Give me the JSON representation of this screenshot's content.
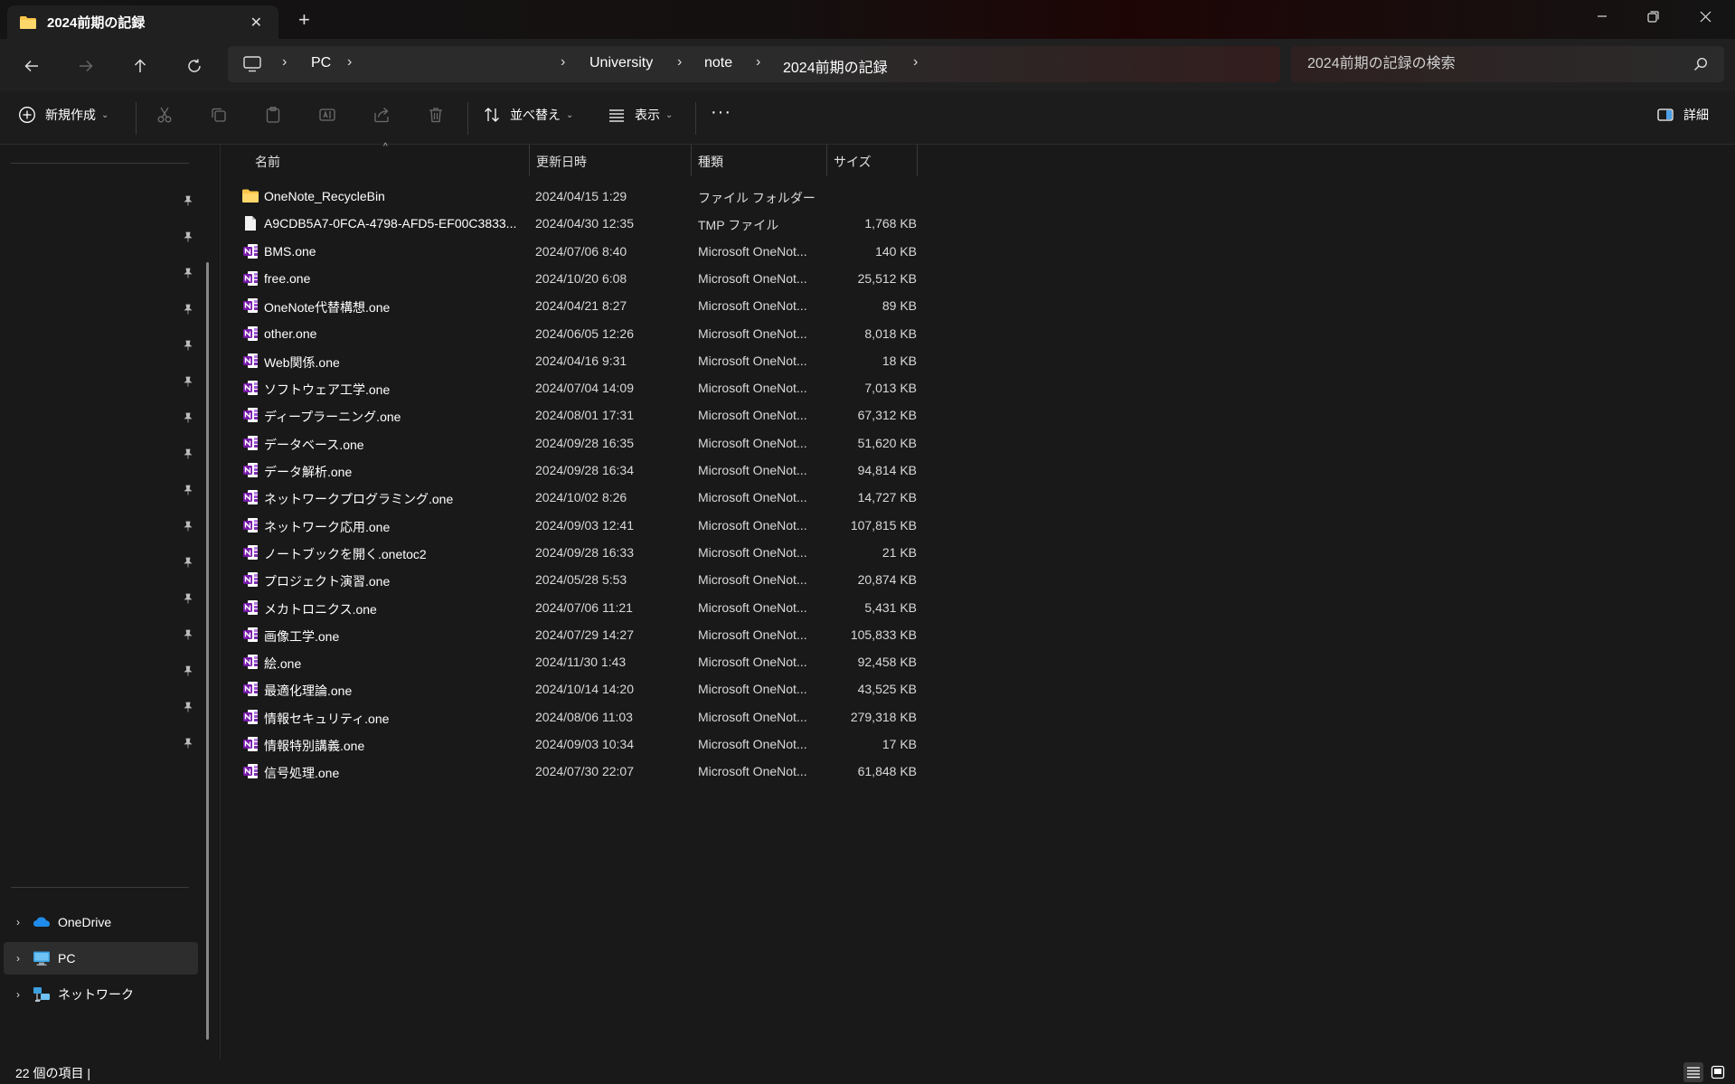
{
  "window": {
    "tab_title": "2024前期の記録",
    "tab_close": "✕",
    "new_tab": "+"
  },
  "address": {
    "crumbs": [
      "PC",
      "University",
      "note",
      "2024前期の記録"
    ],
    "separator": "›",
    "search_placeholder": "2024前期の記録の検索"
  },
  "toolbar": {
    "new_label": "新規作成",
    "sort_label": "並べ替え",
    "view_label": "表示",
    "more_label": "···",
    "details_label": "詳細",
    "chevron": "⌄"
  },
  "sidebar": {
    "items": [
      {
        "label": "OneDrive",
        "icon": "onedrive-icon"
      },
      {
        "label": "PC",
        "icon": "pc-icon"
      },
      {
        "label": "ネットワーク",
        "icon": "network-icon"
      }
    ],
    "expand_glyph": "›"
  },
  "columns": {
    "name": "名前",
    "date": "更新日時",
    "type": "種類",
    "size": "サイズ"
  },
  "files": [
    {
      "name": "OneNote_RecycleBin",
      "date": "2024/04/15 1:29",
      "type": "ファイル フォルダー",
      "size": "",
      "icon": "folder-icon"
    },
    {
      "name": "A9CDB5A7-0FCA-4798-AFD5-EF00C3833...",
      "date": "2024/04/30 12:35",
      "type": "TMP ファイル",
      "size": "1,768 KB",
      "icon": "file-icon"
    },
    {
      "name": "BMS.one",
      "date": "2024/07/06 8:40",
      "type": "Microsoft OneNot...",
      "size": "140 KB",
      "icon": "onenote-icon"
    },
    {
      "name": "free.one",
      "date": "2024/10/20 6:08",
      "type": "Microsoft OneNot...",
      "size": "25,512 KB",
      "icon": "onenote-icon"
    },
    {
      "name": "OneNote代替構想.one",
      "date": "2024/04/21 8:27",
      "type": "Microsoft OneNot...",
      "size": "89 KB",
      "icon": "onenote-icon"
    },
    {
      "name": "other.one",
      "date": "2024/06/05 12:26",
      "type": "Microsoft OneNot...",
      "size": "8,018 KB",
      "icon": "onenote-icon"
    },
    {
      "name": "Web関係.one",
      "date": "2024/04/16 9:31",
      "type": "Microsoft OneNot...",
      "size": "18 KB",
      "icon": "onenote-icon"
    },
    {
      "name": "ソフトウェア工学.one",
      "date": "2024/07/04 14:09",
      "type": "Microsoft OneNot...",
      "size": "7,013 KB",
      "icon": "onenote-icon"
    },
    {
      "name": "ディープラーニング.one",
      "date": "2024/08/01 17:31",
      "type": "Microsoft OneNot...",
      "size": "67,312 KB",
      "icon": "onenote-icon"
    },
    {
      "name": "データベース.one",
      "date": "2024/09/28 16:35",
      "type": "Microsoft OneNot...",
      "size": "51,620 KB",
      "icon": "onenote-icon"
    },
    {
      "name": "データ解析.one",
      "date": "2024/09/28 16:34",
      "type": "Microsoft OneNot...",
      "size": "94,814 KB",
      "icon": "onenote-icon"
    },
    {
      "name": "ネットワークプログラミング.one",
      "date": "2024/10/02 8:26",
      "type": "Microsoft OneNot...",
      "size": "14,727 KB",
      "icon": "onenote-icon"
    },
    {
      "name": "ネットワーク応用.one",
      "date": "2024/09/03 12:41",
      "type": "Microsoft OneNot...",
      "size": "107,815 KB",
      "icon": "onenote-icon"
    },
    {
      "name": "ノートブックを開く.onetoc2",
      "date": "2024/09/28 16:33",
      "type": "Microsoft OneNot...",
      "size": "21 KB",
      "icon": "onenote-icon"
    },
    {
      "name": "プロジェクト演習.one",
      "date": "2024/05/28 5:53",
      "type": "Microsoft OneNot...",
      "size": "20,874 KB",
      "icon": "onenote-icon"
    },
    {
      "name": "メカトロニクス.one",
      "date": "2024/07/06 11:21",
      "type": "Microsoft OneNot...",
      "size": "5,431 KB",
      "icon": "onenote-icon"
    },
    {
      "name": "画像工学.one",
      "date": "2024/07/29 14:27",
      "type": "Microsoft OneNot...",
      "size": "105,833 KB",
      "icon": "onenote-icon"
    },
    {
      "name": "絵.one",
      "date": "2024/11/30 1:43",
      "type": "Microsoft OneNot...",
      "size": "92,458 KB",
      "icon": "onenote-icon"
    },
    {
      "name": "最適化理論.one",
      "date": "2024/10/14 14:20",
      "type": "Microsoft OneNot...",
      "size": "43,525 KB",
      "icon": "onenote-icon"
    },
    {
      "name": "情報セキュリティ.one",
      "date": "2024/08/06 11:03",
      "type": "Microsoft OneNot...",
      "size": "279,318 KB",
      "icon": "onenote-icon"
    },
    {
      "name": "情報特別講義.one",
      "date": "2024/09/03 10:34",
      "type": "Microsoft OneNot...",
      "size": "17 KB",
      "icon": "onenote-icon"
    },
    {
      "name": "信号処理.one",
      "date": "2024/07/30 22:07",
      "type": "Microsoft OneNot...",
      "size": "61,848 KB",
      "icon": "onenote-icon"
    }
  ],
  "status": {
    "item_count": "22 個の項目 |"
  },
  "colors": {
    "background": "#191919",
    "onenote": "#7719aa",
    "folder": "#f8c54a"
  }
}
